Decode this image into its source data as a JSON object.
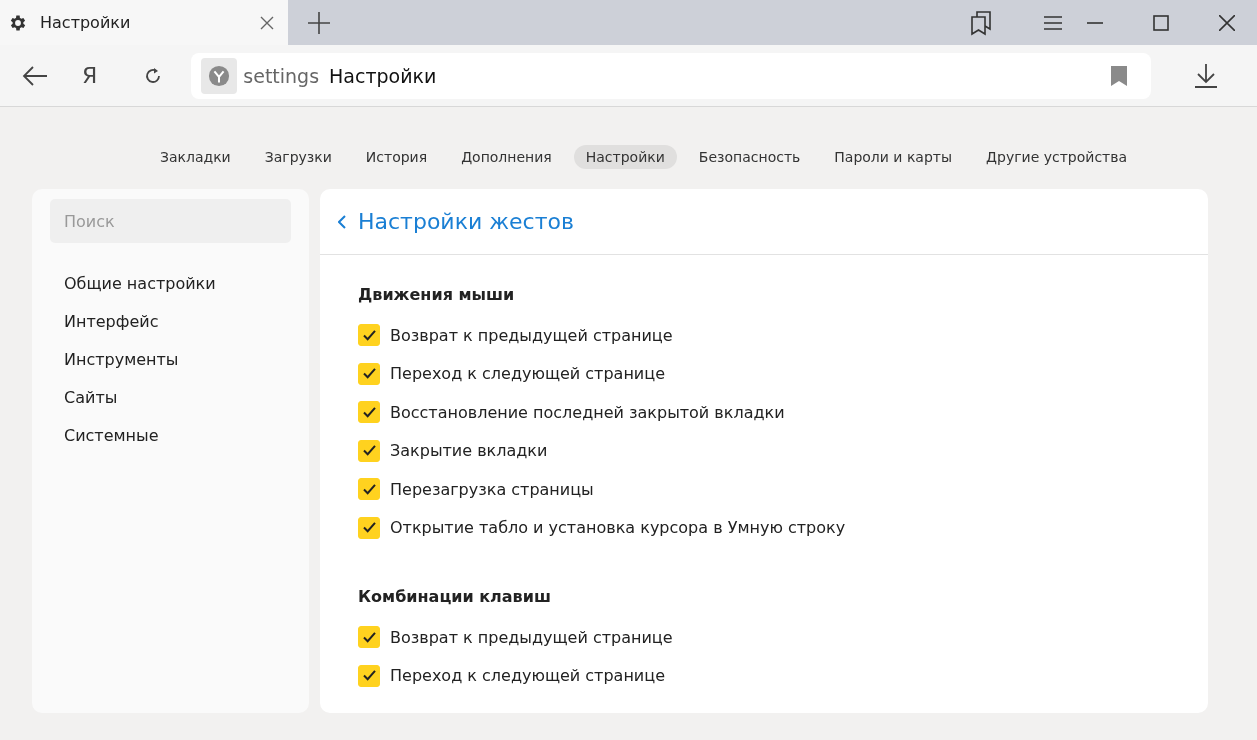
{
  "tab": {
    "title": "Настройки"
  },
  "toolbar": {
    "home_label": "Я"
  },
  "address": {
    "scheme": "settings",
    "title": "Настройки"
  },
  "nav": [
    {
      "label": "Закладки",
      "selected": false
    },
    {
      "label": "Загрузки",
      "selected": false
    },
    {
      "label": "История",
      "selected": false
    },
    {
      "label": "Дополнения",
      "selected": false
    },
    {
      "label": "Настройки",
      "selected": true
    },
    {
      "label": "Безопасность",
      "selected": false
    },
    {
      "label": "Пароли и карты",
      "selected": false
    },
    {
      "label": "Другие устройства",
      "selected": false
    }
  ],
  "sidebar": {
    "search": {
      "placeholder": "Поиск"
    },
    "items": [
      "Общие настройки",
      "Интерфейс",
      "Инструменты",
      "Сайты",
      "Системные"
    ]
  },
  "panel": {
    "title": "Настройки жестов",
    "sections": [
      {
        "title": "Движения мыши",
        "options": [
          {
            "label": "Возврат к предыдущей странице",
            "checked": true
          },
          {
            "label": "Переход к следующей странице",
            "checked": true
          },
          {
            "label": "Восстановление последней закрытой вкладки",
            "checked": true
          },
          {
            "label": "Закрытие вкладки",
            "checked": true
          },
          {
            "label": "Перезагрузка страницы",
            "checked": true
          },
          {
            "label": "Открытие табло и установка курсора в Умную строку",
            "checked": true
          }
        ]
      },
      {
        "title": "Комбинации клавиш",
        "options": [
          {
            "label": "Возврат к предыдущей странице",
            "checked": true
          },
          {
            "label": "Переход к следующей странице",
            "checked": true
          }
        ]
      }
    ]
  }
}
